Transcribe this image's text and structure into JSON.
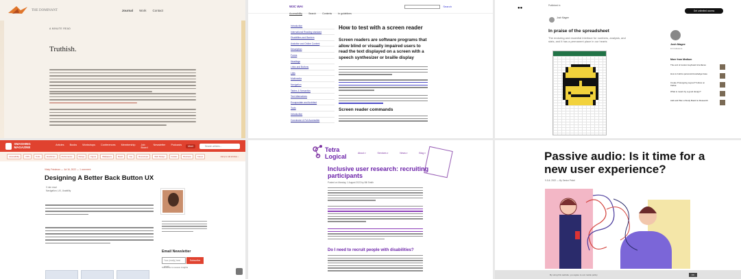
{
  "tile1": {
    "brand": "THE DOMINANT",
    "nav": [
      "Journal",
      "Work",
      "Contact"
    ],
    "kicker": "A MINUTE READ",
    "title": "Truthish."
  },
  "tile2": {
    "site": "W3C WAI",
    "search_go": "Search",
    "tabs": [
      "Accessibility",
      "Search",
      "Contents",
      "In guidelines"
    ],
    "side_items": [
      "Introduction",
      "International Reading standard",
      "Disabilities and Barriers",
      "Assistive and Online Content",
      "Description",
      "Forms",
      "Headings",
      "Links and Buttons",
      "Lists",
      "Multimedia",
      "Navigation",
      "Tables & Semantics",
      "Text Alternatives",
      "Encapsulate and Architect",
      "Tools",
      "Introduction",
      "Conclusion & Full Accessible"
    ],
    "title": "How to test with a screen reader",
    "lead": "Screen readers are software programs that allow blind or visually impaired users to read the text displayed on a screen with a speech synthesizer or braille display",
    "h2": "Screen reader commands"
  },
  "tile3": {
    "publication": "Published in",
    "author": "Josh Magee",
    "title": "In praise of the spreadsheet",
    "subtitle": "The enduring and essential interface for numbers, analysis, and stats, and it has a permanent place in our hearts",
    "follow_btn": "Get unlimited access",
    "sidebar_name": "Josh Magee",
    "sidebar_followers": "1K Followers",
    "more_heading": "More from Medium",
    "more_items": [
      "The end of custom keyboard interfaces",
      "How to build a personal knowledge base",
      "Create Prototyping Layout? Follow on TikTok",
      "What is meant by a good design?",
      "Add and Plan a Study Board to Research"
    ]
  },
  "tile4": {
    "logo": "SMASHING MAGAZINE",
    "nav": [
      "Articles",
      "Books",
      "Workshops",
      "Conferences",
      "Membership",
      "Job Board",
      "Newsletter",
      "Podcasts"
    ],
    "meet": "Meet",
    "search_placeholder": "Search articles...",
    "tags": [
      "Accessibility",
      "CSS",
      "Tools",
      "JavaScript",
      "Performance",
      "Design",
      "Figma",
      "Wallpapers",
      "React",
      "Vue",
      "Round-Ups",
      "Web Design",
      "Guides",
      "Business",
      "Career",
      "Privacy"
    ],
    "jump": "Jump to all articles ›",
    "byline": "Vitaly Friedman — Jul 16, 2022 — 1 comment",
    "title": "Designing A Better Back Button UX",
    "meta": [
      "3 min read",
      "Navigation, UX, Usability"
    ],
    "newsletter_title": "Email Newsletter",
    "newsletter_placeholder": "Your (really) best email",
    "newsletter_btn": "Subscribe",
    "newsletter_cb": "Subscribe to receive insights"
  },
  "tile5": {
    "logo_line1": "Tetra",
    "logo_line2": "Logical",
    "nav": [
      "About",
      "Services",
      "News",
      "Blog"
    ],
    "title": "Inclusive user research: recruiting participants",
    "posted": "Posted on Monday, 1 August 2022 by Bill Smith",
    "h2": "Do I need to recruit people with disabilities?"
  },
  "tile6": {
    "title": "Passive audio: Is it time for a new user experience?",
    "meta": "9 JUL 2022 — By Senior Pekel",
    "cookie_text": "By using this website, you agree to our cookie policy.",
    "cookie_btn": "OK"
  }
}
